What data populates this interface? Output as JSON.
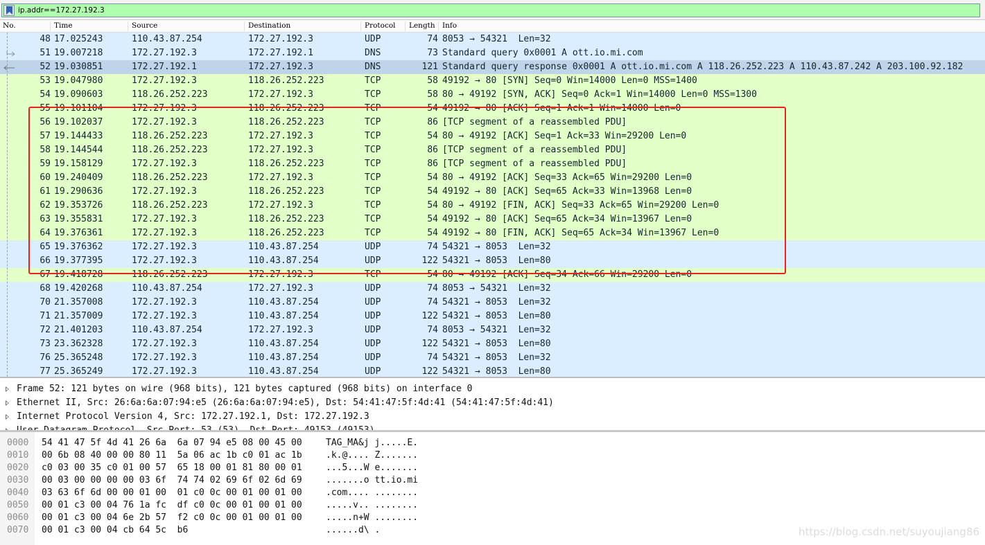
{
  "filter": {
    "value": "ip.addr==172.27.192.3",
    "bookmark_icon": "bookmark-icon"
  },
  "columns": [
    "No.",
    "Time",
    "Source",
    "Destination",
    "Protocol",
    "Length",
    "Info"
  ],
  "packets": [
    {
      "no": "48",
      "time": "17.025243",
      "src": "110.43.87.254",
      "dst": "172.27.192.3",
      "proto": "UDP",
      "len": "74",
      "info": "8053 → 54321  Len=32"
    },
    {
      "no": "51",
      "time": "19.007218",
      "src": "172.27.192.3",
      "dst": "172.27.192.1",
      "proto": "DNS",
      "len": "73",
      "info": "Standard query 0x0001 A ott.io.mi.com"
    },
    {
      "no": "52",
      "time": "19.030851",
      "src": "172.27.192.1",
      "dst": "172.27.192.3",
      "proto": "DNS",
      "len": "121",
      "info": "Standard query response 0x0001 A ott.io.mi.com A 118.26.252.223 A 110.43.87.242 A 203.100.92.182"
    },
    {
      "no": "53",
      "time": "19.047980",
      "src": "172.27.192.3",
      "dst": "118.26.252.223",
      "proto": "TCP",
      "len": "58",
      "info": "49192 → 80 [SYN] Seq=0 Win=14000 Len=0 MSS=1400"
    },
    {
      "no": "54",
      "time": "19.090603",
      "src": "118.26.252.223",
      "dst": "172.27.192.3",
      "proto": "TCP",
      "len": "58",
      "info": "80 → 49192 [SYN, ACK] Seq=0 Ack=1 Win=14000 Len=0 MSS=1300"
    },
    {
      "no": "55",
      "time": "19.101104",
      "src": "172.27.192.3",
      "dst": "118.26.252.223",
      "proto": "TCP",
      "len": "54",
      "info": "49192 → 80 [ACK] Seq=1 Ack=1 Win=14000 Len=0"
    },
    {
      "no": "56",
      "time": "19.102037",
      "src": "172.27.192.3",
      "dst": "118.26.252.223",
      "proto": "TCP",
      "len": "86",
      "info": "[TCP segment of a reassembled PDU]"
    },
    {
      "no": "57",
      "time": "19.144433",
      "src": "118.26.252.223",
      "dst": "172.27.192.3",
      "proto": "TCP",
      "len": "54",
      "info": "80 → 49192 [ACK] Seq=1 Ack=33 Win=29200 Len=0"
    },
    {
      "no": "58",
      "time": "19.144544",
      "src": "118.26.252.223",
      "dst": "172.27.192.3",
      "proto": "TCP",
      "len": "86",
      "info": "[TCP segment of a reassembled PDU]"
    },
    {
      "no": "59",
      "time": "19.158129",
      "src": "172.27.192.3",
      "dst": "118.26.252.223",
      "proto": "TCP",
      "len": "86",
      "info": "[TCP segment of a reassembled PDU]"
    },
    {
      "no": "60",
      "time": "19.240409",
      "src": "118.26.252.223",
      "dst": "172.27.192.3",
      "proto": "TCP",
      "len": "54",
      "info": "80 → 49192 [ACK] Seq=33 Ack=65 Win=29200 Len=0"
    },
    {
      "no": "61",
      "time": "19.290636",
      "src": "172.27.192.3",
      "dst": "118.26.252.223",
      "proto": "TCP",
      "len": "54",
      "info": "49192 → 80 [ACK] Seq=65 Ack=33 Win=13968 Len=0"
    },
    {
      "no": "62",
      "time": "19.353726",
      "src": "118.26.252.223",
      "dst": "172.27.192.3",
      "proto": "TCP",
      "len": "54",
      "info": "80 → 49192 [FIN, ACK] Seq=33 Ack=65 Win=29200 Len=0"
    },
    {
      "no": "63",
      "time": "19.355831",
      "src": "172.27.192.3",
      "dst": "118.26.252.223",
      "proto": "TCP",
      "len": "54",
      "info": "49192 → 80 [ACK] Seq=65 Ack=34 Win=13967 Len=0"
    },
    {
      "no": "64",
      "time": "19.376361",
      "src": "172.27.192.3",
      "dst": "118.26.252.223",
      "proto": "TCP",
      "len": "54",
      "info": "49192 → 80 [FIN, ACK] Seq=65 Ack=34 Win=13967 Len=0"
    },
    {
      "no": "65",
      "time": "19.376362",
      "src": "172.27.192.3",
      "dst": "110.43.87.254",
      "proto": "UDP",
      "len": "74",
      "info": "54321 → 8053  Len=32"
    },
    {
      "no": "66",
      "time": "19.377395",
      "src": "172.27.192.3",
      "dst": "110.43.87.254",
      "proto": "UDP",
      "len": "122",
      "info": "54321 → 8053  Len=80"
    },
    {
      "no": "67",
      "time": "19.418728",
      "src": "118.26.252.223",
      "dst": "172.27.192.3",
      "proto": "TCP",
      "len": "54",
      "info": "80 → 49192 [ACK] Seq=34 Ack=66 Win=29200 Len=0"
    },
    {
      "no": "68",
      "time": "19.420268",
      "src": "110.43.87.254",
      "dst": "172.27.192.3",
      "proto": "UDP",
      "len": "74",
      "info": "8053 → 54321  Len=32"
    },
    {
      "no": "70",
      "time": "21.357008",
      "src": "172.27.192.3",
      "dst": "110.43.87.254",
      "proto": "UDP",
      "len": "74",
      "info": "54321 → 8053  Len=32"
    },
    {
      "no": "71",
      "time": "21.357009",
      "src": "172.27.192.3",
      "dst": "110.43.87.254",
      "proto": "UDP",
      "len": "122",
      "info": "54321 → 8053  Len=80"
    },
    {
      "no": "72",
      "time": "21.401203",
      "src": "110.43.87.254",
      "dst": "172.27.192.3",
      "proto": "UDP",
      "len": "74",
      "info": "8053 → 54321  Len=32"
    },
    {
      "no": "73",
      "time": "23.362328",
      "src": "172.27.192.3",
      "dst": "110.43.87.254",
      "proto": "UDP",
      "len": "122",
      "info": "54321 → 8053  Len=80"
    },
    {
      "no": "76",
      "time": "25.365248",
      "src": "172.27.192.3",
      "dst": "110.43.87.254",
      "proto": "UDP",
      "len": "74",
      "info": "54321 → 8053  Len=32"
    },
    {
      "no": "77",
      "time": "25.365249",
      "src": "172.27.192.3",
      "dst": "110.43.87.254",
      "proto": "UDP",
      "len": "122",
      "info": "54321 → 8053  Len=80"
    }
  ],
  "selected_packet": "52",
  "details": [
    "Frame 52: 121 bytes on wire (968 bits), 121 bytes captured (968 bits) on interface 0",
    "Ethernet II, Src: 26:6a:6a:07:94:e5 (26:6a:6a:07:94:e5), Dst: 54:41:47:5f:4d:41 (54:41:47:5f:4d:41)",
    "Internet Protocol Version 4, Src: 172.27.192.1, Dst: 172.27.192.3",
    "User Datagram Protocol, Src Port: 53 (53), Dst Port: 49153 (49153)"
  ],
  "bytes": [
    {
      "offset": "0000",
      "hex": "54 41 47 5f 4d 41 26 6a  6a 07 94 e5 08 00 45 00",
      "ascii": "TAG_MA&j j.....E."
    },
    {
      "offset": "0010",
      "hex": "00 6b 08 40 00 00 80 11  5a 06 ac 1b c0 01 ac 1b",
      "ascii": ".k.@.... Z......."
    },
    {
      "offset": "0020",
      "hex": "c0 03 00 35 c0 01 00 57  65 18 00 01 81 80 00 01",
      "ascii": "...5...W e......."
    },
    {
      "offset": "0030",
      "hex": "00 03 00 00 00 00 03 6f  74 74 02 69 6f 02 6d 69",
      "ascii": ".......o tt.io.mi"
    },
    {
      "offset": "0040",
      "hex": "03 63 6f 6d 00 00 01 00  01 c0 0c 00 01 00 01 00",
      "ascii": ".com.... ........"
    },
    {
      "offset": "0050",
      "hex": "00 01 c3 00 04 76 1a fc  df c0 0c 00 01 00 01 00",
      "ascii": ".....v.. ........"
    },
    {
      "offset": "0060",
      "hex": "00 01 c3 00 04 6e 2b 57  f2 c0 0c 00 01 00 01 00",
      "ascii": ".....n+W ........"
    },
    {
      "offset": "0070",
      "hex": "00 01 c3 00 04 cb 64 5c  b6",
      "ascii": "......d\\ ."
    }
  ],
  "colors": {
    "udp_row": "#daeeff",
    "tcp_row": "#e4ffc7",
    "selected_row": "#bfd4e8",
    "highlight_box": "#e8231c",
    "filter_ok": "#afffaf"
  },
  "watermark": "https://blog.csdn.net/suyoujiang86"
}
